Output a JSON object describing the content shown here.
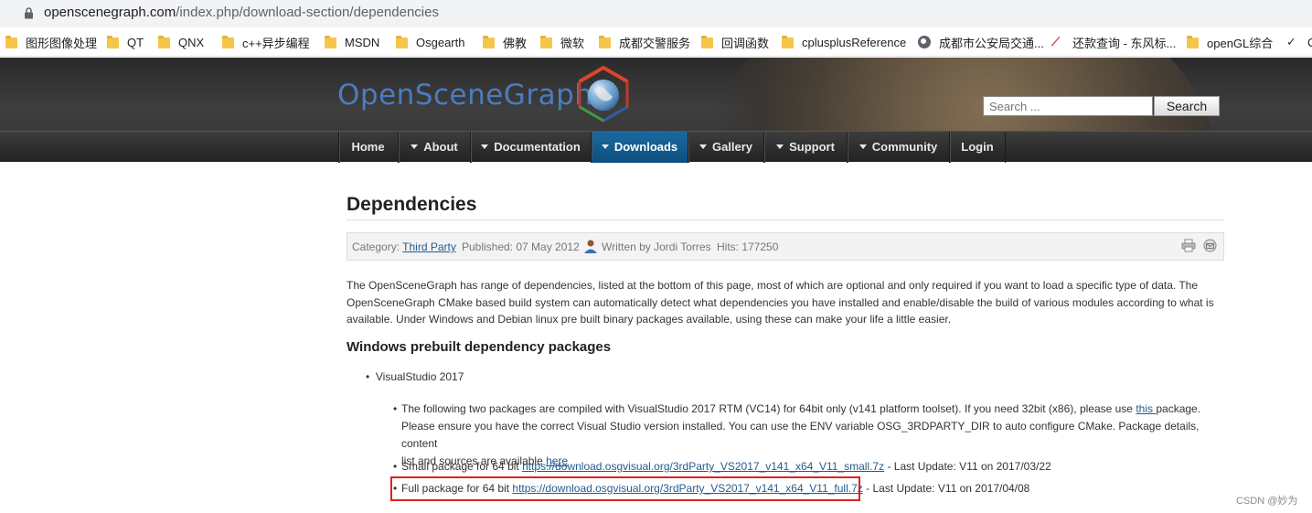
{
  "browser": {
    "url_domain": "openscenegraph.com",
    "url_path": "/index.php/download-section/dependencies"
  },
  "bookmarks": [
    {
      "label": "图形图像处理",
      "icon": "folder-icon"
    },
    {
      "label": "QT",
      "icon": "folder-icon"
    },
    {
      "label": "QNX",
      "icon": "folder-icon"
    },
    {
      "label": "c++异步编程",
      "icon": "folder-icon"
    },
    {
      "label": "MSDN",
      "icon": "folder-icon"
    },
    {
      "label": "Osgearth",
      "icon": "folder-icon"
    },
    {
      "label": "佛教",
      "icon": "folder-icon"
    },
    {
      "label": "微软",
      "icon": "folder-icon"
    },
    {
      "label": "成都交警服务",
      "icon": "folder-icon"
    },
    {
      "label": "回调函数",
      "icon": "folder-icon"
    },
    {
      "label": "cplusplusReference",
      "icon": "folder-icon"
    },
    {
      "label": "成都市公安局交通...",
      "icon": "globe-icon"
    },
    {
      "label": "还款查询 - 东风标...",
      "icon": "brand-icon"
    },
    {
      "label": "openGL综合",
      "icon": "folder-icon"
    },
    {
      "label": "C",
      "icon": "tick-icon"
    }
  ],
  "header": {
    "logo_text": "OpenSceneGraph",
    "search_placeholder": "Search ...",
    "search_button": "Search"
  },
  "nav": [
    {
      "label": "Home",
      "dropdown": false,
      "active": false
    },
    {
      "label": "About",
      "dropdown": true,
      "active": false
    },
    {
      "label": "Documentation",
      "dropdown": true,
      "active": false
    },
    {
      "label": "Downloads",
      "dropdown": true,
      "active": true
    },
    {
      "label": "Gallery",
      "dropdown": true,
      "active": false
    },
    {
      "label": "Support",
      "dropdown": true,
      "active": false
    },
    {
      "label": "Community",
      "dropdown": true,
      "active": false
    },
    {
      "label": "Login",
      "dropdown": false,
      "active": false
    }
  ],
  "article": {
    "title": "Dependencies",
    "category_label": "Category:",
    "category_link": "Third Party",
    "published": "Published: 07 May 2012",
    "author": "Written by Jordi Torres",
    "hits": "Hits: 177250",
    "intro": "The OpenSceneGraph has range of dependencies, listed at the bottom of this page, most of which are optional and only required if you want to load a specific type of data. The OpenSceneGraph CMake based build system can automatically detect what dependencies you have installed and enable/disable the build of various modules according to what is available. Under Windows and Debian linux pre built binary packages available, using these can make your life a little easier.",
    "subheading": "Windows prebuilt dependency packages",
    "vs_item": "VisualStudio 2017",
    "note_before_link": "The following two packages are compiled with VisualStudio 2017 RTM (VC14) for 64bit only (v141 platform toolset). If you need 32bit (x86), please use ",
    "note_this_link": "this ",
    "note_mid1": "package.",
    "note_line2": "Please ensure you have the correct Visual Studio version installed. You can use the ENV variable OSG_3RDPARTY_DIR to auto configure CMake. Package details, content",
    "note_line3": "list and sources are available ",
    "note_here_link": "here",
    "small_prefix": "Small package for 64 bit ",
    "small_link": "https://download.osgvisual.org/3rdParty_VS2017_v141_x64_V11_small.7z",
    "small_suffix": " - Last Update: V11 on 2017/03/22",
    "full_prefix": "Full package for 64 bit ",
    "full_link": "https://download.osgvisual.org/3rdParty_VS2017_v141_x64_V11_full.7z",
    "full_suffix": " - Last Update: V11 on 2017/04/08"
  },
  "watermark": "CSDN @妙为",
  "colors": {
    "link": "#245c8f",
    "nav_active": "#1a6aa0",
    "highlight_border": "#e02020",
    "logo": "#4b7cbf"
  }
}
